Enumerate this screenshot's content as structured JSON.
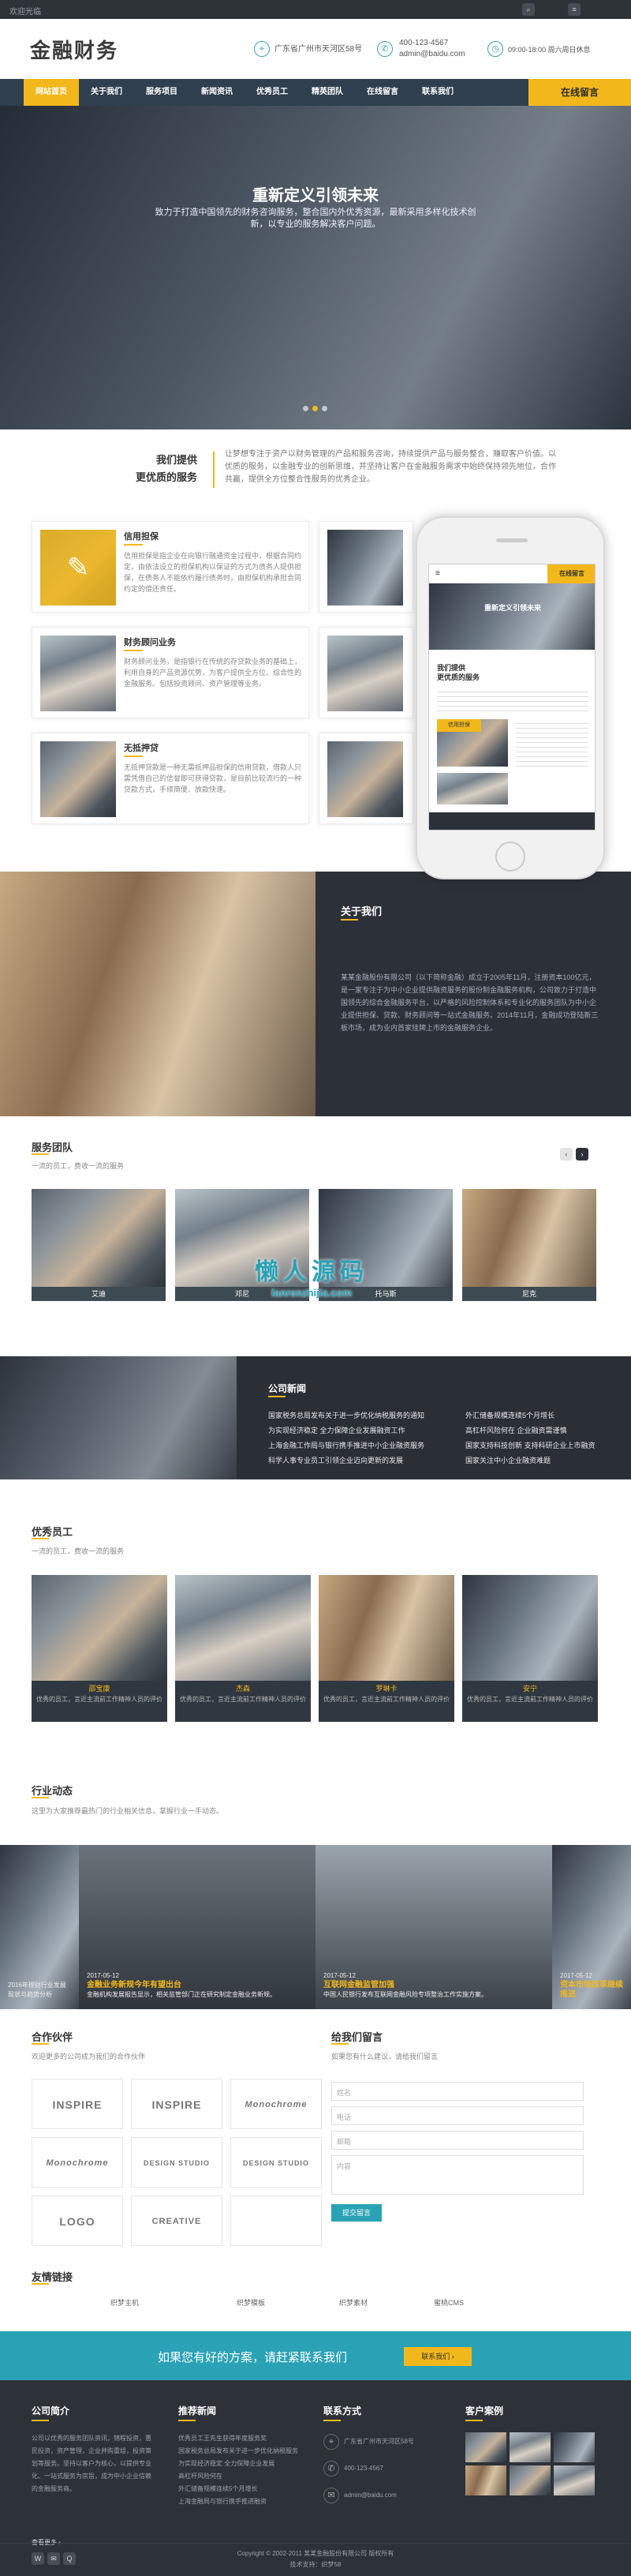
{
  "topbar": {
    "welcome": "欢迎光临"
  },
  "header": {
    "logo": "金融财务",
    "address": "广东省广州市天河区58号",
    "phone": "400-123-4567",
    "email": "admin@baidu.com",
    "hours": "09:00-18:00 周六周日休息"
  },
  "nav": {
    "items": [
      "网站首页",
      "关于我们",
      "服务项目",
      "新闻资讯",
      "优秀员工",
      "精英团队",
      "在线留言",
      "联系我们"
    ],
    "cta": "在线留言"
  },
  "hero": {
    "title": "重新定义引领未来",
    "subtitle": "致力于打造中国领先的财务咨询服务，整合国内外优秀资源，最新采用多样化技术创新，以专业的服务解决客户问题。"
  },
  "service": {
    "title1": "我们提供",
    "title2": "更优质的服务",
    "intro": "让梦想专注于资产以财务管理的产品和服务咨询，持续提供产品与服务整合，赚取客户价值。以优质的服务，以金融专业的创新思维，并坚持让客户在金融服务需求中始终保持领先地位，合作共赢，提供全方位整合性服务的优秀企业。"
  },
  "cards": [
    {
      "title": "信用担保",
      "text": "信用担保是指企业在向银行融通资金过程中，根据合同约定，由依法设立的担保机构以保证的方式为债务人提供担保，在债务人不能依约履行债务时，由担保机构承担合同约定的偿还责任。"
    },
    {
      "title": "财务顾问业务",
      "text": "财务顾问业务，是指银行在传统的存贷款业务的基础上，利用自身的产品资源优势，为客户提供全方位、综合性的金融服务。包括投资顾问、资产管理等业务。"
    },
    {
      "title": "无抵押贷",
      "text": "无抵押贷款是一种无需抵押品担保的信用贷款，借款人只需凭借自己的信誉即可获得贷款，是目前比较流行的一种贷款方式，手续简便、放款快速。"
    }
  ],
  "phone_screen": {
    "cta": "在线留言",
    "banner": "重新定义引领未来",
    "title1": "我们提供",
    "title2": "更优质的服务",
    "card": "信用担保"
  },
  "about": {
    "title": "关于我们",
    "text": "某某金融股份有限公司（以下简称金融）成立于2005年11月，注册资本100亿元，是一家专注于为中小企业提供融资服务的股份制金融服务机构，公司致力于打造中国领先的综合金融服务平台，以严格的风险控制体系和专业化的服务团队为中小企业提供担保、贷款、财务顾问等一站式金融服务。2014年11月，金融成功登陆新三板市场，成为业内首家挂牌上市的金融服务企业。"
  },
  "team": {
    "title": "服务团队",
    "subtitle": "一流的员工，费收一流的服务",
    "members": [
      "艾迪",
      "邓尼",
      "托马斯",
      "尼克"
    ],
    "prev": "‹",
    "next": "›"
  },
  "watermark": {
    "title": "懒人源码",
    "url": "lanrenzhijia.com"
  },
  "news": {
    "title": "公司新闻",
    "left": [
      "国家税务总局发布关于进一步优化纳税服务的通知",
      "为实现经济稳定 全力保障企业发展融资工作",
      "上海金融工作局与银行携手推进中小企业融资服务",
      "科学人事专业员工引领企业迈向更新的发展"
    ],
    "right": [
      "外汇储备规模连续5个月增长",
      "高杠杆风险何在 企业融资需谨慎",
      "国家支持科技创新 支持科研企业上市融资",
      "国家关注中小企业融资难题"
    ]
  },
  "staff": {
    "title": "优秀员工",
    "subtitle": "一流的员工，费收一流的服务",
    "members": [
      {
        "name": "邵宝康",
        "text": "优秀的员工，言近主流前工作精神人员的评价"
      },
      {
        "name": "杰森",
        "text": "优秀的员工，言近主流前工作精神人员的评价"
      },
      {
        "name": "罗琳卡",
        "text": "优秀的员工，言近主流前工作精神人员的评价"
      },
      {
        "name": "安宁",
        "text": "优秀的员工，言近主流前工作精神人员的评价"
      }
    ]
  },
  "industry": {
    "title": "行业动态",
    "subtitle": "这里为大家推荐最热门的行业相关信息，掌握行业一手动态。",
    "items": [
      {
        "date": "",
        "title": "",
        "text": "2016年理财行业发展现状与趋势分析"
      },
      {
        "date": "2017-05-12",
        "title": "金融业务新规今年有望出台",
        "text": "金融机构发展报告显示，相关监管部门正在研究制定金融业务新规。"
      },
      {
        "date": "2017-05-12",
        "title": "互联网金融监管加强",
        "text": "中国人民银行发布互联网金融风险专项整治工作实施方案。"
      },
      {
        "date": "2017-05-12",
        "title": "资本市场改革继续推进",
        "text": ""
      }
    ]
  },
  "partners": {
    "title": "合作伙伴",
    "subtitle": "欢迎更多的公司成为我们的合作伙伴",
    "logos": [
      "INSPIRE",
      "INSPIRE",
      "Monochrome",
      "Monochrome",
      "DESIGN STUDIO",
      "DESIGN STUDIO",
      "LOGO",
      "CREATIVE"
    ]
  },
  "message": {
    "title": "给我们留言",
    "subtitle": "如果您有什么建议，请给我们留言",
    "name_ph": "姓名",
    "phone_ph": "电话",
    "email_ph": "邮箱",
    "content_ph": "内容",
    "submit": "提交留言"
  },
  "links": {
    "title": "友情链接",
    "items": [
      "织梦主机",
      "织梦模板",
      "织梦素材",
      "蜜桃CMS"
    ]
  },
  "cta": {
    "text": "如果您有好的方案，请赶紧联系我们",
    "button": "联系我们 ›"
  },
  "footer": {
    "about_title": "公司简介",
    "about_text": "公司以优秀的服务团队资讯，锦程投资，惠民投资，资产管理，企业并购重组，投资策划等服务。坚持以客户为核心，以提供专业化、一站式服务为宗旨，成为中小企业信赖的金融服务商。",
    "more": "查看更多 ›",
    "news_title": "推荐新闻",
    "news": [
      "优秀员工王先生获得年度服务奖",
      "国家税务总局发布关于进一步优化纳税服务",
      "为实现经济稳定 全力保障企业发展",
      "高杠杆风险何在",
      "外汇储备规模连续5个月增长",
      "上海金融局与银行携手推进融资"
    ],
    "contact_title": "联系方式",
    "contact": [
      "广东省广州市天河区58号",
      "400-123-4567",
      "admin@baidu.com"
    ],
    "cases_title": "客户案例",
    "copyright": "Copyright © 2002-2011 某某金融股份有限公司 版权所有",
    "icp": "技术支持：织梦58"
  },
  "colors": {
    "accent": "#f2b81b",
    "teal": "#2aa2b5",
    "dark": "#2c3139",
    "nav": "#2f3f4d"
  }
}
